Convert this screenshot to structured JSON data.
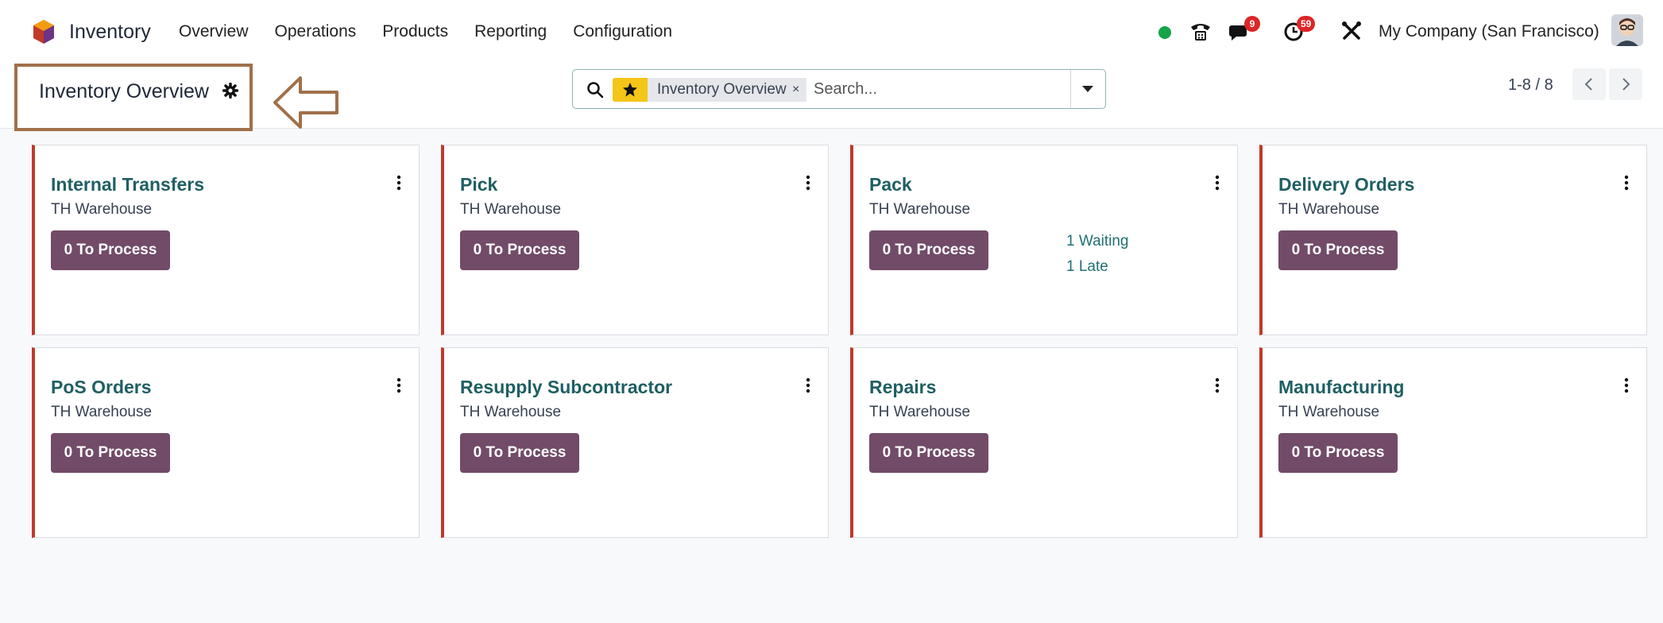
{
  "navbar": {
    "app_name": "Inventory",
    "menu": [
      "Overview",
      "Operations",
      "Products",
      "Reporting",
      "Configuration"
    ],
    "messages_badge": "9",
    "activities_badge": "59",
    "company": "My Company (San Francisco)"
  },
  "control_panel": {
    "title": "Inventory Overview",
    "search": {
      "facet": "Inventory Overview",
      "facet_remove": "×",
      "placeholder": "Search..."
    },
    "pager": "1-8 / 8"
  },
  "cards": [
    {
      "title": "Internal Transfers",
      "warehouse": "TH Warehouse",
      "button": "0 To Process"
    },
    {
      "title": "Pick",
      "warehouse": "TH Warehouse",
      "button": "0 To Process"
    },
    {
      "title": "Pack",
      "warehouse": "TH Warehouse",
      "button": "0 To Process",
      "links": [
        "1 Waiting",
        "1 Late"
      ]
    },
    {
      "title": "Delivery Orders",
      "warehouse": "TH Warehouse",
      "button": "0 To Process"
    },
    {
      "title": "PoS Orders",
      "warehouse": "TH Warehouse",
      "button": "0 To Process"
    },
    {
      "title": "Resupply Subcontractor",
      "warehouse": "TH Warehouse",
      "button": "0 To Process"
    },
    {
      "title": "Repairs",
      "warehouse": "TH Warehouse",
      "button": "0 To Process"
    },
    {
      "title": "Manufacturing",
      "warehouse": "TH Warehouse",
      "button": "0 To Process"
    }
  ],
  "colors": {
    "brand": "#714b67",
    "card_accent": "#c0392b",
    "link": "#1f5f63",
    "annotation": "#a0704a"
  }
}
